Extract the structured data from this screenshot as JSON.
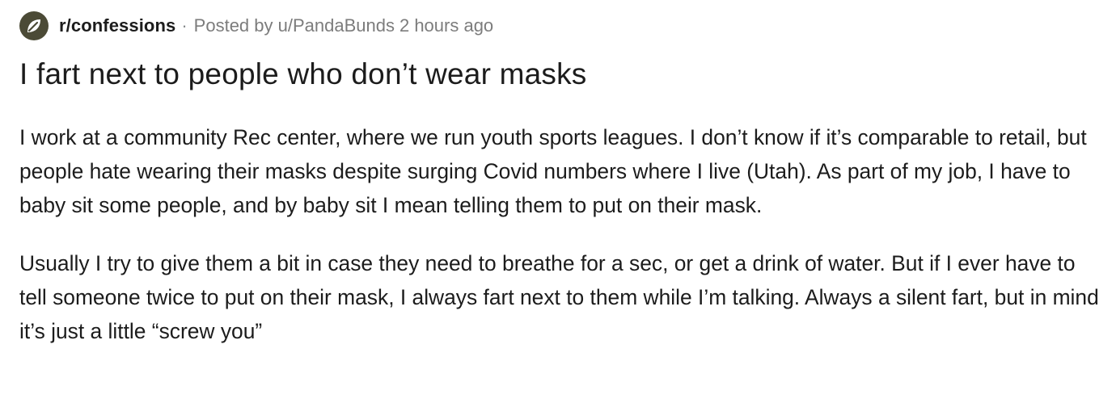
{
  "post": {
    "subreddit": "r/confessions",
    "separator": "·",
    "posted_by": "Posted by u/PandaBunds",
    "time_ago": "2 hours ago",
    "title": "I fart next to people who don’t wear masks",
    "paragraphs": [
      "I work at a community Rec center, where we run youth sports leagues. I don’t know if it’s comparable to retail, but people hate wearing their masks despite surging Covid numbers where I live (Utah). As part of my job, I have to baby sit some people, and by baby sit I mean telling them to put on their mask.",
      "Usually I try to give them a bit in case they need to breathe for a sec, or get a drink of water. But if I ever have to tell someone twice to put on their mask, I always fart next to them while I’m talking. Always a silent fart, but in mind it’s just a little “screw you”"
    ]
  },
  "icons": {
    "subreddit_avatar": "leaf-icon"
  },
  "colors": {
    "avatar_bg": "#4b4a36",
    "text": "#1c1c1c",
    "meta_gray": "#7c7c7c"
  }
}
